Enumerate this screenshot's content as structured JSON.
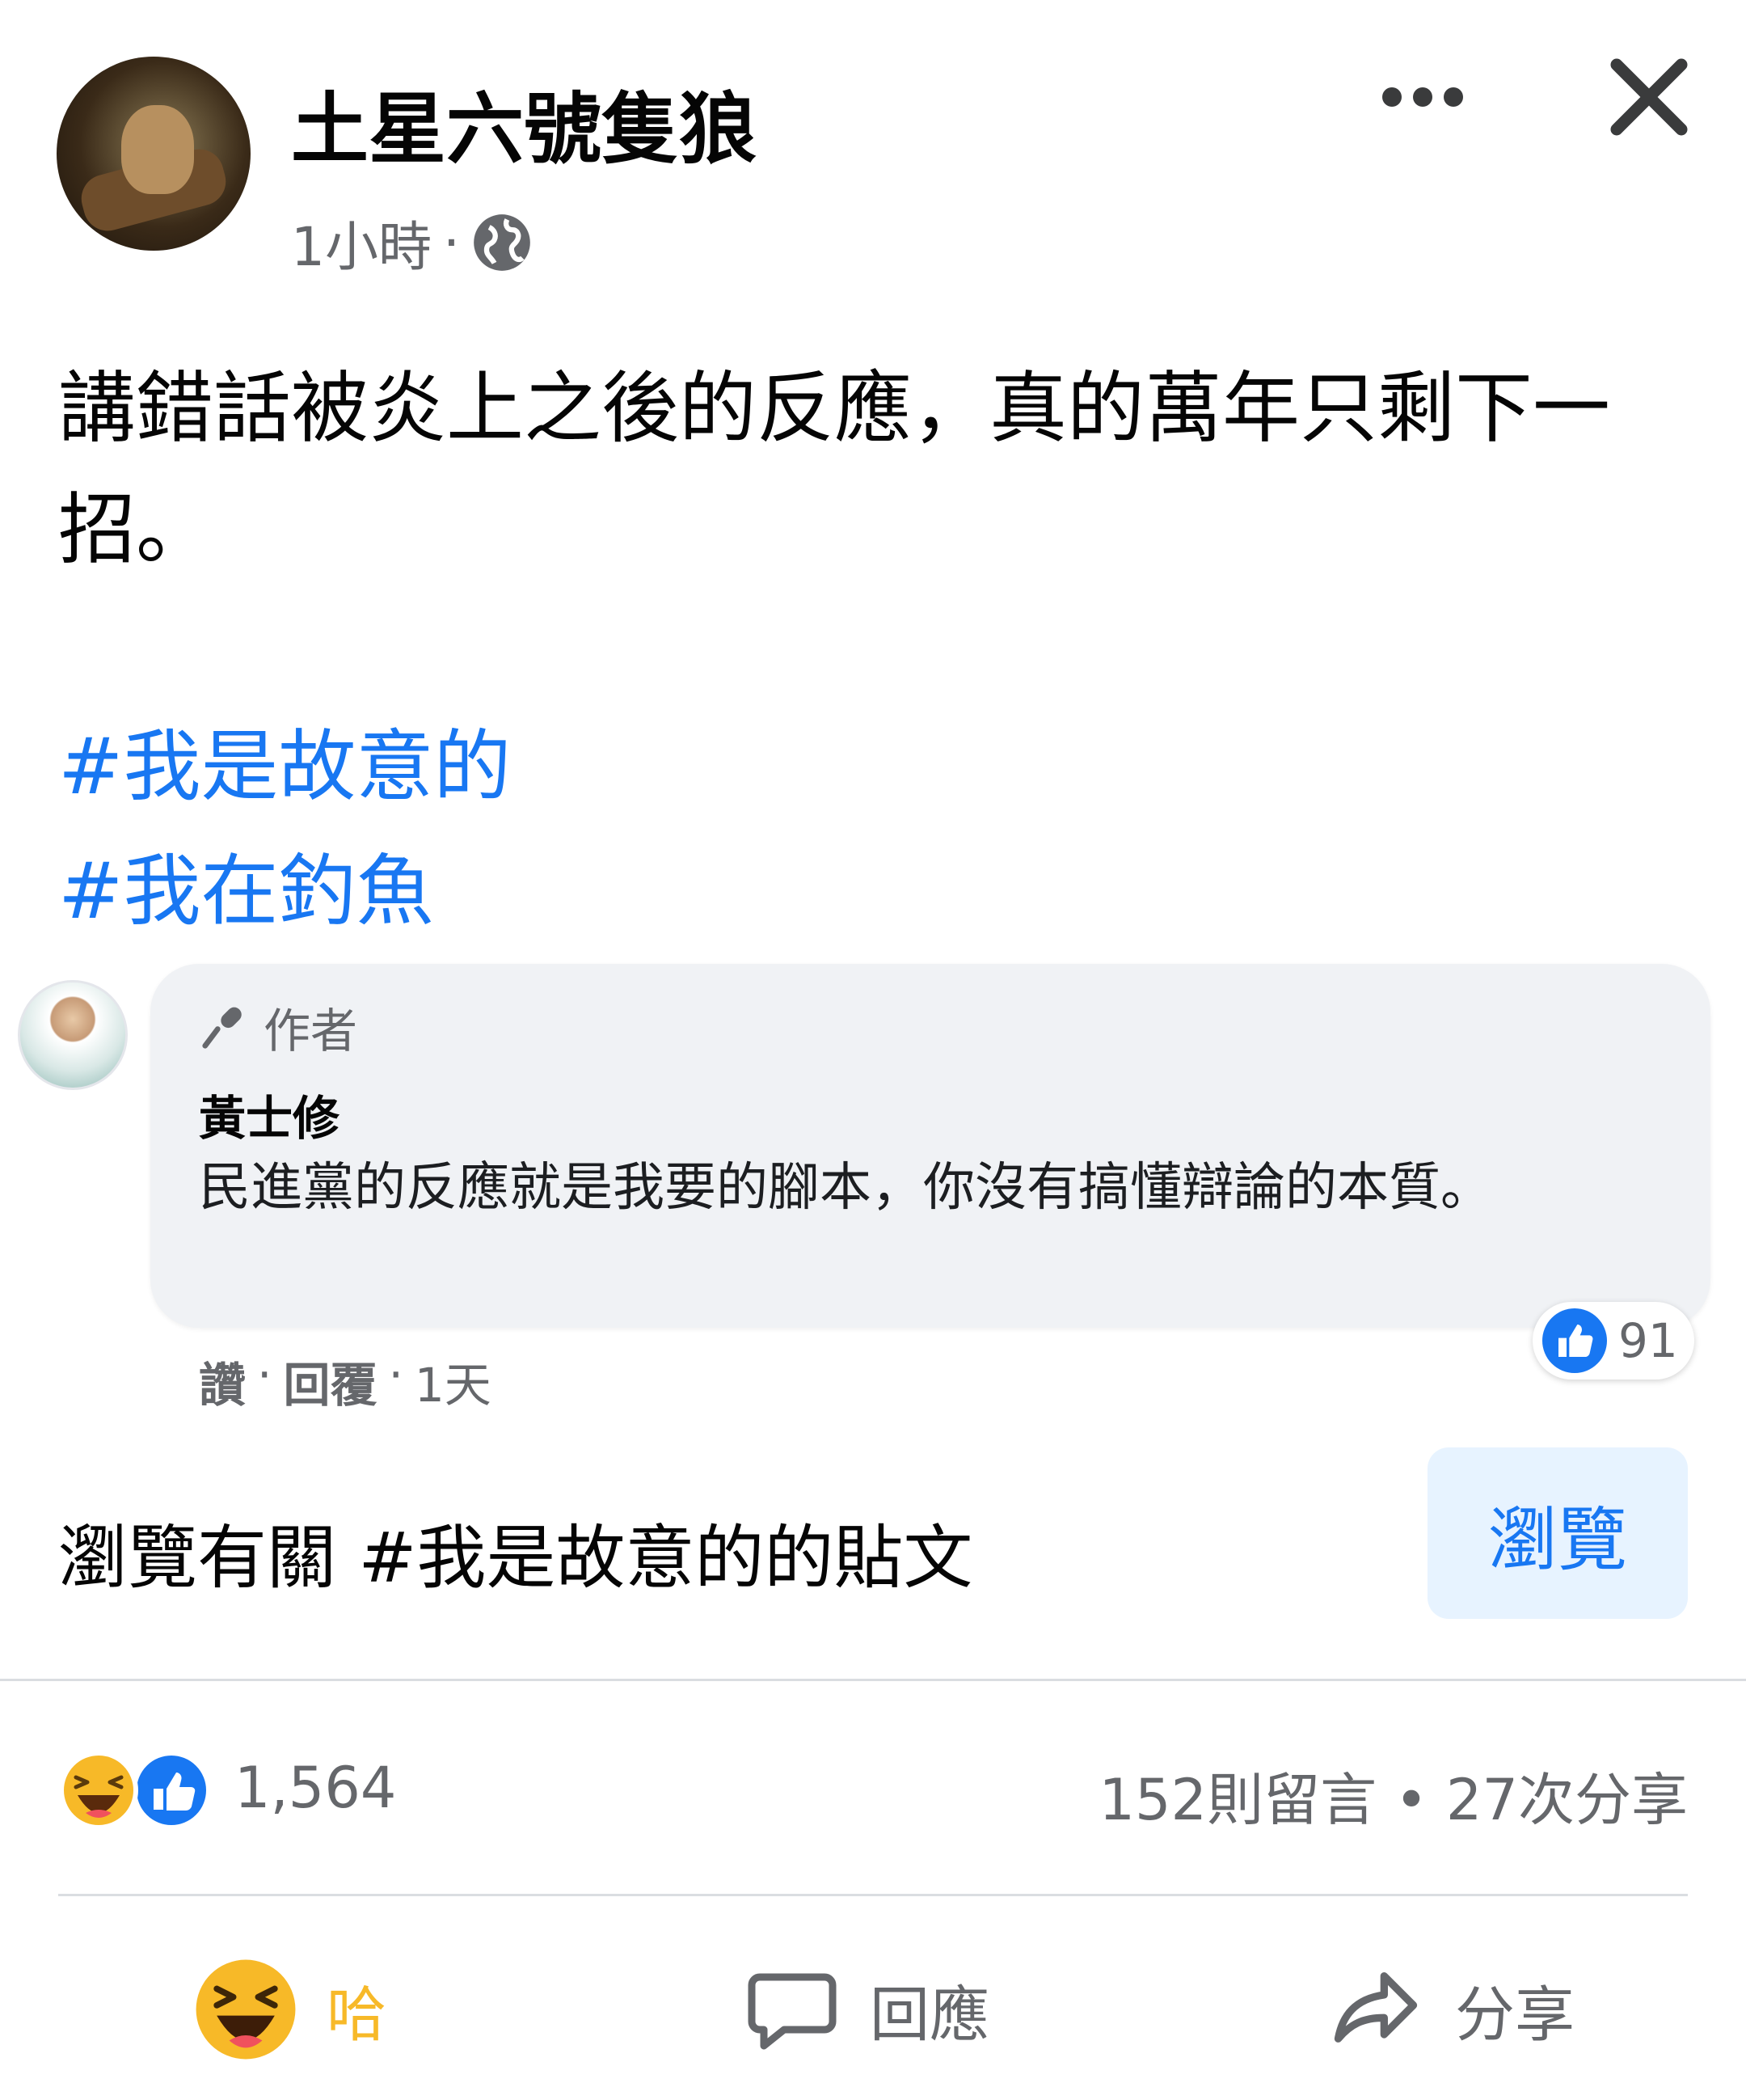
{
  "post": {
    "page_name": "土星六號隻狼",
    "time": "1小時",
    "meta_sep": "·",
    "text": "講錯話被炎上之後的反應，真的萬年只剩下一招。",
    "hashtags": [
      "#我是故意的",
      "#我在釣魚"
    ]
  },
  "comment": {
    "badge": "作者",
    "name": "黃士修",
    "text": "民進黨的反應就是我要的腳本，你沒有搞懂辯論的本質。",
    "like_count": "91",
    "like_label": "讚",
    "reply_label": "回覆",
    "time": "1天",
    "sep": "·"
  },
  "browse": {
    "text": "瀏覽有關 #我是故意的的貼文",
    "button": "瀏覽"
  },
  "stats": {
    "reaction_count": "1,564",
    "comments": "152則留言",
    "sep": "•",
    "shares": "27次分享"
  },
  "actions": {
    "haha": "哈",
    "comment": "回應",
    "share": "分享"
  },
  "colors": {
    "link": "#1877f2",
    "secondary_text": "#65676b",
    "haha": "#f7b928",
    "bubble": "#f0f2f5",
    "browse_button_bg": "#e7f3ff"
  }
}
